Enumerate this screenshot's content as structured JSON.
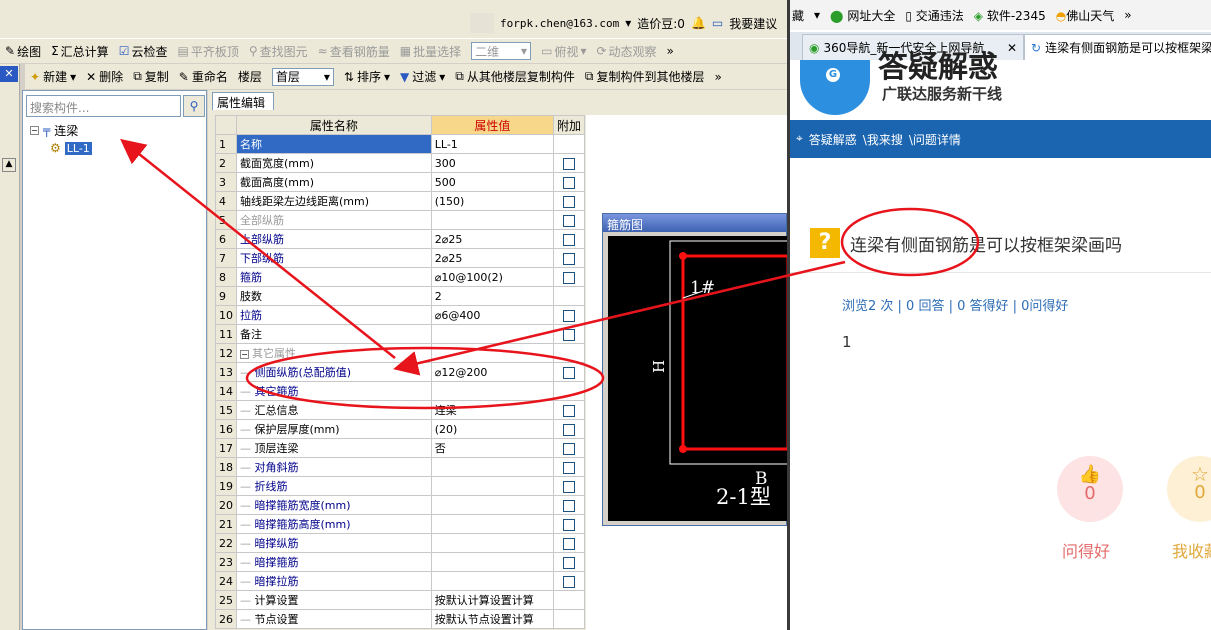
{
  "app": {
    "account": "forpk.chen@163.com",
    "cost_bean": "造价豆:0",
    "suggest": "我要建议",
    "toolbar1": [
      {
        "label": "绘图",
        "icon": "pencil-icon",
        "enabled": true
      },
      {
        "label": "汇总计算",
        "icon": "sigma-icon",
        "enabled": true
      },
      {
        "label": "云检查",
        "icon": "cloud-check-icon",
        "enabled": true
      },
      {
        "label": "平齐板顶",
        "icon": "align-icon",
        "enabled": false
      },
      {
        "label": "查找图元",
        "icon": "find-icon",
        "enabled": false
      },
      {
        "label": "查看钢筋量",
        "icon": "rebar-icon",
        "enabled": false
      },
      {
        "label": "批量选择",
        "icon": "batch-icon",
        "enabled": false
      },
      {
        "label": "二维",
        "icon": "2d-icon",
        "enabled": false
      },
      {
        "label": "俯视",
        "icon": "view-icon",
        "enabled": false
      },
      {
        "label": "动态观察",
        "icon": "orbit-icon",
        "enabled": false
      }
    ],
    "toolbar2": {
      "new": "新建",
      "delete": "删除",
      "copy": "复制",
      "rename": "重命名",
      "floor": "楼层",
      "floor_value": "首层",
      "sort": "排序",
      "filter": "过滤",
      "copy_from": "从其他楼层复制构件",
      "copy_to": "复制构件到其他楼层"
    },
    "search_placeholder": "搜索构件...",
    "tree": {
      "root": "连梁",
      "child": "LL-1"
    },
    "prop_tab": "属性编辑",
    "grid_headers": [
      "属性名称",
      "属性值",
      "附加"
    ],
    "rows": [
      {
        "n": "1",
        "name": "名称",
        "val": "LL-1",
        "cb": false,
        "cls": "sel"
      },
      {
        "n": "2",
        "name": "截面宽度(mm)",
        "val": "300",
        "cb": true,
        "cls": ""
      },
      {
        "n": "3",
        "name": "截面高度(mm)",
        "val": "500",
        "cb": true,
        "cls": ""
      },
      {
        "n": "4",
        "name": "轴线距梁左边线距离(mm)",
        "val": "(150)",
        "cb": true,
        "cls": ""
      },
      {
        "n": "5",
        "name": "全部纵筋",
        "val": "",
        "cb": true,
        "cls": "gray"
      },
      {
        "n": "6",
        "name": "上部纵筋",
        "val": "2⌀25",
        "cb": true,
        "cls": "blue"
      },
      {
        "n": "7",
        "name": "下部纵筋",
        "val": "2⌀25",
        "cb": true,
        "cls": "blue"
      },
      {
        "n": "8",
        "name": "箍筋",
        "val": "⌀10@100(2)",
        "cb": true,
        "cls": "blue"
      },
      {
        "n": "9",
        "name": "肢数",
        "val": "2",
        "cb": false,
        "cls": ""
      },
      {
        "n": "10",
        "name": "拉筋",
        "val": "⌀6@400",
        "cb": true,
        "cls": "blue"
      },
      {
        "n": "11",
        "name": "备注",
        "val": "",
        "cb": true,
        "cls": ""
      },
      {
        "n": "12",
        "name": "其它属性",
        "val": "",
        "cb": false,
        "cls": "gray grp"
      },
      {
        "n": "13",
        "name": "侧面纵筋(总配筋值)",
        "val": "⌀12@200",
        "cb": true,
        "cls": "blue ind"
      },
      {
        "n": "14",
        "name": "其它箍筋",
        "val": "",
        "cb": false,
        "cls": "blue ind"
      },
      {
        "n": "15",
        "name": "汇总信息",
        "val": "连梁",
        "cb": true,
        "cls": "ind"
      },
      {
        "n": "16",
        "name": "保护层厚度(mm)",
        "val": "(20)",
        "cb": true,
        "cls": "ind"
      },
      {
        "n": "17",
        "name": "顶层连梁",
        "val": "否",
        "cb": true,
        "cls": "ind"
      },
      {
        "n": "18",
        "name": "对角斜筋",
        "val": "",
        "cb": true,
        "cls": "blue ind"
      },
      {
        "n": "19",
        "name": "折线筋",
        "val": "",
        "cb": true,
        "cls": "blue ind"
      },
      {
        "n": "20",
        "name": "暗撑箍筋宽度(mm)",
        "val": "",
        "cb": true,
        "cls": "blue ind"
      },
      {
        "n": "21",
        "name": "暗撑箍筋高度(mm)",
        "val": "",
        "cb": true,
        "cls": "blue ind"
      },
      {
        "n": "22",
        "name": "暗撑纵筋",
        "val": "",
        "cb": true,
        "cls": "blue ind"
      },
      {
        "n": "23",
        "name": "暗撑箍筋",
        "val": "",
        "cb": true,
        "cls": "blue ind"
      },
      {
        "n": "24",
        "name": "暗撑拉筋",
        "val": "",
        "cb": true,
        "cls": "blue ind"
      },
      {
        "n": "25",
        "name": "计算设置",
        "val": "按默认计算设置计算",
        "cb": false,
        "cls": "ind"
      },
      {
        "n": "26",
        "name": "节点设置",
        "val": "按默认节点设置计算",
        "cb": false,
        "cls": "ind"
      }
    ],
    "stirrup": {
      "title": "箍筋图",
      "label_1": "1#",
      "label_h": "H",
      "label_b": "B",
      "type": "2-1型"
    }
  },
  "browser": {
    "bookmarks": [
      "藏",
      "网址大全",
      "交通违法",
      "软件-2345",
      "佛山天气"
    ],
    "tabs": [
      "360导航_新一代安全上网导航",
      "连梁有侧面钢筋是可以按框架梁画吗"
    ],
    "banner_big": "答疑解惑",
    "banner_sub": "广联达服务新干线",
    "crumb": [
      "答疑解惑",
      "\\我来搜",
      "\\问题详情"
    ],
    "question": "连梁有侧面钢筋是可以按框架梁画吗",
    "stats": "浏览2 次 | 0 回答 | 0 答得好 | 0问得好",
    "answer": "1",
    "good_count": "0",
    "good_label": "问得好",
    "fav_count": "0",
    "fav_label": "我收藏"
  },
  "colors": {
    "accent": "#316ac5",
    "annotation": "#e8141c",
    "crumb_bg": "#1a64b0",
    "good_bg": "#fde3e3",
    "fav_bg": "#fdf0d5"
  }
}
